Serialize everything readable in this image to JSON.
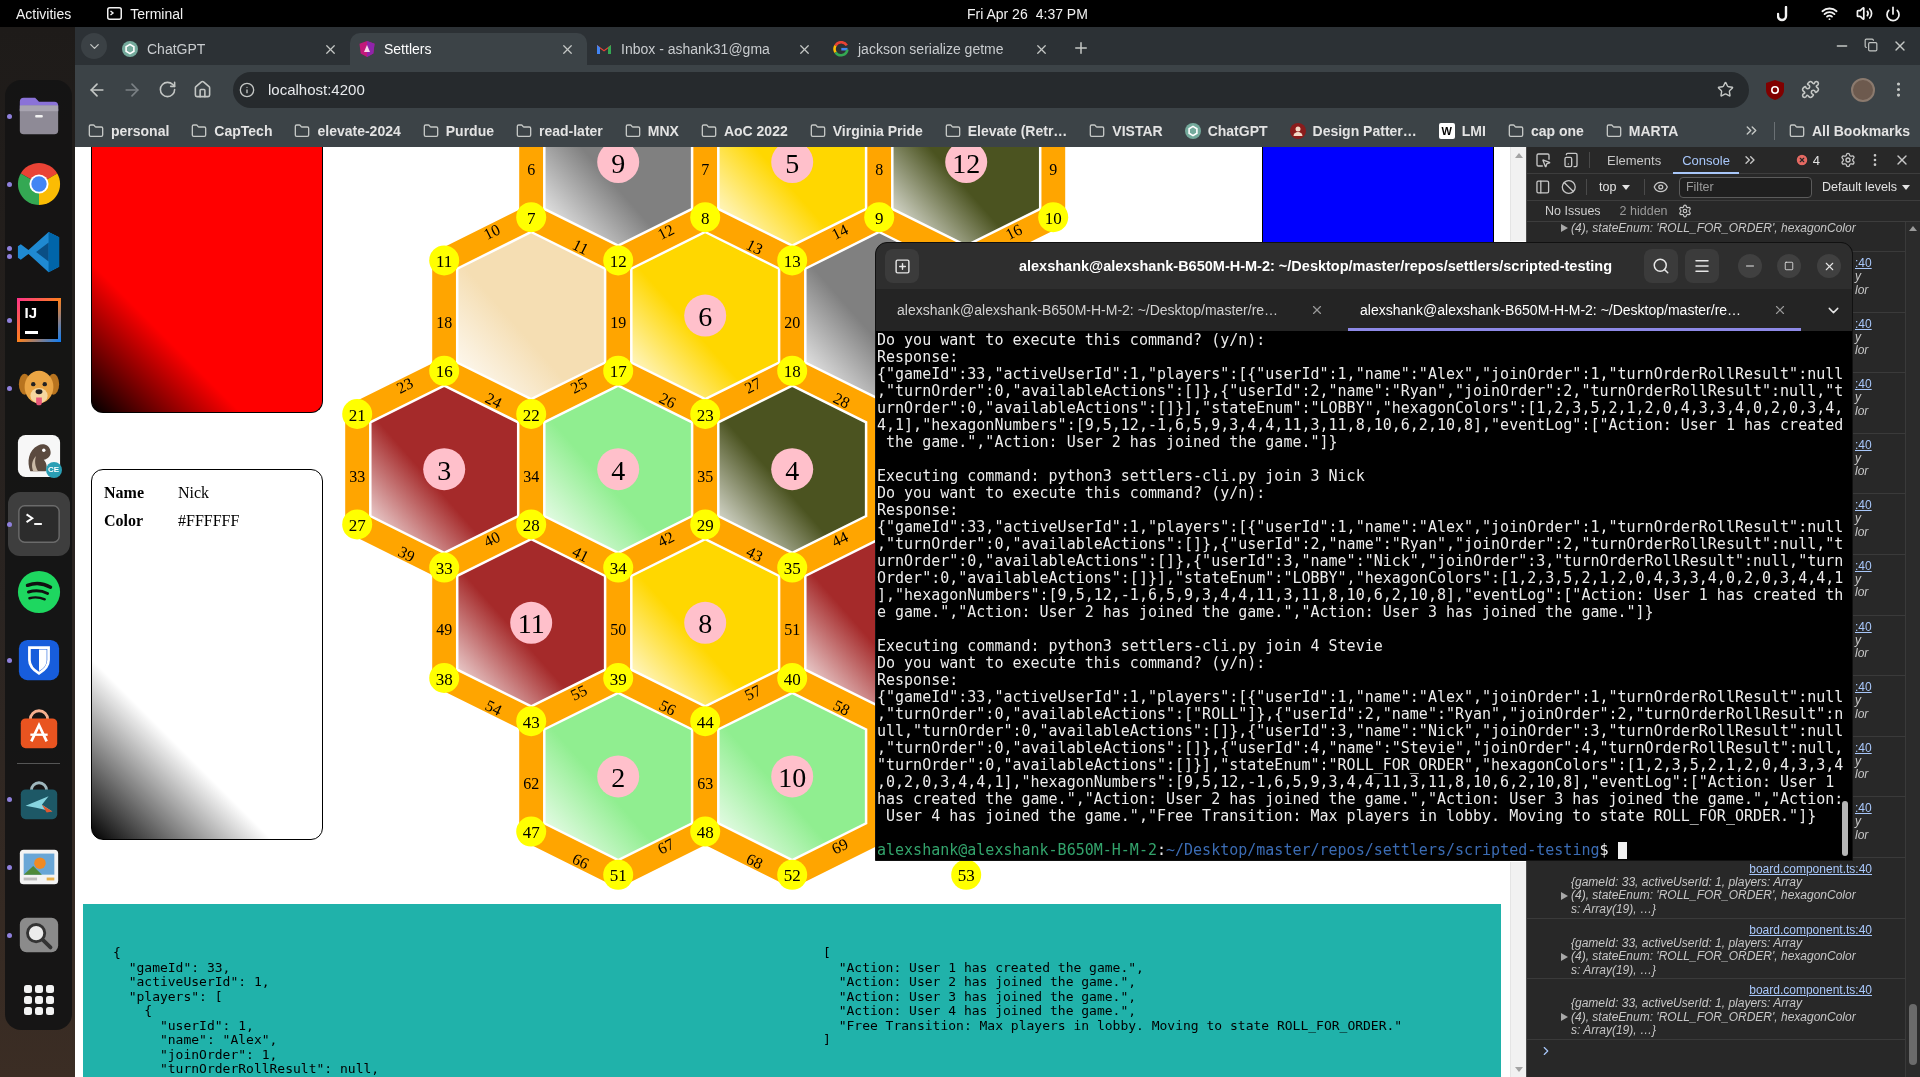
{
  "top_bar": {
    "activities": "Activities",
    "app_name": "Terminal",
    "date": "Fri Apr 26",
    "time": "4:37 PM"
  },
  "dock": {
    "apps": [
      {
        "kind": "files",
        "running": true,
        "multiple_windows": false,
        "selected": false
      },
      {
        "kind": "browser",
        "running": true,
        "multiple_windows": false,
        "selected": false
      },
      {
        "kind": "editor",
        "running": true,
        "multiple_windows": true,
        "selected": false
      },
      {
        "kind": "ide",
        "glyph": "IJ",
        "running": true,
        "multiple_windows": false,
        "selected": false
      },
      {
        "kind": "dog",
        "running": true,
        "multiple_windows": false,
        "selected": false
      },
      {
        "kind": "beaver",
        "glyph": "CE",
        "running": false,
        "multiple_windows": false,
        "selected": false
      },
      {
        "kind": "terminal",
        "running": true,
        "multiple_windows": false,
        "selected": true
      },
      {
        "kind": "music",
        "running": false,
        "multiple_windows": false,
        "selected": false
      },
      {
        "kind": "vault",
        "running": true,
        "multiple_windows": false,
        "selected": false
      },
      {
        "kind": "store",
        "running": false,
        "multiple_windows": false,
        "selected": false
      }
    ],
    "extra_apps": [
      {
        "kind": "bag",
        "running": true,
        "multiple_windows": false,
        "selected": false
      },
      {
        "kind": "photos",
        "running": true,
        "multiple_windows": false,
        "selected": false
      },
      {
        "kind": "search",
        "running": true,
        "multiple_windows": false,
        "selected": false
      }
    ]
  },
  "browser": {
    "tabs": [
      {
        "title": "ChatGPT",
        "kind": "knot",
        "selected": false
      },
      {
        "title": "Settlers",
        "kind": "shield",
        "selected": true
      },
      {
        "title": "Inbox - ashank31@gma",
        "kind": "mail",
        "selected": false
      },
      {
        "title": "jackson serialize getme",
        "kind": "ring",
        "selected": false
      }
    ],
    "url": "localhost:4200",
    "bookmarks": [
      {
        "title": "personal",
        "kind": "folder"
      },
      {
        "title": "CapTech",
        "kind": "folder"
      },
      {
        "title": "elevate-2024",
        "kind": "folder"
      },
      {
        "title": "Purdue",
        "kind": "folder"
      },
      {
        "title": "read-later",
        "kind": "folder"
      },
      {
        "title": "MNX",
        "kind": "folder"
      },
      {
        "title": "AoC 2022",
        "kind": "folder"
      },
      {
        "title": "Virginia Pride",
        "kind": "folder"
      },
      {
        "title": "Elevate (Retr…",
        "kind": "folder"
      },
      {
        "title": "VISTAR",
        "kind": "folder"
      },
      {
        "title": "ChatGPT",
        "kind": "knot"
      },
      {
        "title": "Design Patter…",
        "kind": "badge"
      },
      {
        "title": "LMI",
        "kind": "letter",
        "glyph": "W"
      },
      {
        "title": "cap one",
        "kind": "folder"
      },
      {
        "title": "MARTA",
        "kind": "folder"
      }
    ],
    "all_bookmarks": "All Bookmarks"
  },
  "page": {
    "left_cards": [
      {
        "color": "#ff0000"
      },
      {
        "color": "#ffffff",
        "fields": [
          {
            "label": "Name",
            "value": "Nick"
          },
          {
            "label": "Color",
            "value": "#FFFFFF"
          }
        ]
      }
    ],
    "right_cards": [
      {
        "color": "#0000ff"
      }
    ],
    "board": {
      "hex_rows": [
        [
          {
            "color": "#808080",
            "number": "9"
          },
          {
            "color": "#ffd700",
            "number": "5"
          },
          {
            "color": "#4b5320",
            "number": "12"
          }
        ],
        [
          {
            "color": "#f5deb3"
          },
          {
            "color": "#ffd700",
            "number": "6"
          },
          {
            "color": "#808080"
          }
        ],
        [
          {
            "color": "#a52a2a",
            "number": "3"
          },
          {
            "color": "#90ee90",
            "number": "4"
          },
          {
            "color": "#4b5320",
            "number": "4"
          }
        ],
        [
          {
            "color": "#a52a2a",
            "number": "11"
          },
          {
            "color": "#ffd700",
            "number": "8"
          },
          {
            "color": "#a52a2a"
          }
        ],
        [
          {
            "color": "#90ee90",
            "number": "2"
          },
          {
            "color": "#90ee90",
            "number": "10"
          }
        ]
      ],
      "vertex_rows": [
        [
          "7",
          "8",
          "9",
          "10"
        ],
        [
          "11",
          "12",
          "13"
        ],
        [
          "16",
          "17",
          "18"
        ],
        [
          "21",
          "22",
          "23"
        ],
        [
          "27",
          "28",
          "29"
        ],
        [
          "33",
          "34",
          "35"
        ],
        [
          "38",
          "39",
          "40"
        ],
        [
          "43",
          "44"
        ],
        [
          "47",
          "48"
        ],
        [
          "51",
          "52",
          "53"
        ]
      ],
      "edge_rows": [
        [
          "6",
          "7",
          "8",
          "9"
        ],
        [
          "10",
          "11",
          "12",
          "13",
          "14",
          null,
          "16"
        ],
        [
          "18",
          "19",
          "20"
        ],
        [
          "23",
          "24",
          "25",
          "26",
          "27",
          "28"
        ],
        [
          "33",
          "34",
          "35"
        ],
        [
          "39",
          "40",
          "41",
          "42",
          "43",
          "44"
        ],
        [
          "49",
          "50",
          "51"
        ],
        [
          "54",
          "55",
          "56",
          "57",
          "58"
        ],
        [
          "62",
          "63"
        ],
        [
          "66",
          "67",
          "68",
          "69"
        ]
      ]
    },
    "state_lines": [
      "{",
      "  \"gameId\": 33,",
      "  \"activeUserId\": 1,",
      "  \"players\": [",
      "    {",
      "      \"userId\": 1,",
      "      \"name\": \"Alex\",",
      "      \"joinOrder\": 1,",
      "      \"turnOrderRollResult\": null,"
    ],
    "event_lines": [
      "[",
      "  \"Action: User 1 has created the game.\",",
      "  \"Action: User 2 has joined the game.\",",
      "  \"Action: User 3 has joined the game.\",",
      "  \"Action: User 4 has joined the game.\",",
      "  \"Free Transition: Max players in lobby. Moving to state ROLL_FOR_ORDER.\"",
      "]"
    ]
  },
  "devtools": {
    "tabs": [
      {
        "label": "Elements",
        "selected": false
      },
      {
        "label": "Console",
        "selected": true
      }
    ],
    "error_count": "4",
    "context": "top",
    "filter_placeholder": "Filter",
    "levels": "Default levels",
    "issues": "No Issues",
    "hidden": "2 hidden",
    "messages": [
      {
        "kind": "tail",
        "lines": [
          "(4), stateEnum: 'ROLL_FOR_ORDER', hexagonColor"
        ]
      },
      {
        "kind": "partial",
        "fragments": [
          ":40",
          "y",
          "lor"
        ]
      },
      {
        "kind": "partial",
        "fragments": [
          ":40",
          "y",
          "lor"
        ]
      },
      {
        "kind": "partial",
        "fragments": [
          ":40",
          "y",
          "lor"
        ]
      },
      {
        "kind": "partial",
        "fragments": [
          ":40",
          "y",
          "lor"
        ]
      },
      {
        "kind": "partial",
        "fragments": [
          ":40",
          "y",
          "lor"
        ]
      },
      {
        "kind": "partial",
        "fragments": [
          ":40",
          "y",
          "lor"
        ]
      },
      {
        "kind": "partial",
        "fragments": [
          ":40",
          "y",
          "lor"
        ]
      },
      {
        "kind": "partial",
        "fragments": [
          ":40",
          "y",
          "lor"
        ]
      },
      {
        "kind": "partial",
        "fragments": [
          ":40",
          "y",
          "lor"
        ]
      },
      {
        "kind": "partial",
        "fragments": [
          ":40",
          "y",
          "lor"
        ]
      },
      {
        "kind": "full",
        "source": "board.component.ts:40",
        "lines": [
          "{gameId: 33, activeUserId: 1, players: Array",
          "(4), stateEnum: 'ROLL_FOR_ORDER', hexagonColor",
          "s: Array(19), …}"
        ]
      },
      {
        "kind": "full",
        "source": "board.component.ts:40",
        "lines": [
          "{gameId: 33, activeUserId: 1, players: Array",
          "(4), stateEnum: 'ROLL_FOR_ORDER', hexagonColor",
          "s: Array(19), …}"
        ]
      },
      {
        "kind": "full",
        "source": "board.component.ts:40",
        "lines": [
          "{gameId: 33, activeUserId: 1, players: Array",
          "(4), stateEnum: 'ROLL_FOR_ORDER', hexagonColor",
          "s: Array(19), …}"
        ]
      }
    ]
  },
  "terminal": {
    "title": "alexshank@alexshank-B650M-H-M-2: ~/Desktop/master/repos/settlers/scripted-testing",
    "tabs": [
      {
        "title": "alexshank@alexshank-B650M-H-M-2: ~/Desktop/master/re…",
        "selected": false
      },
      {
        "title": "alexshank@alexshank-B650M-H-M-2: ~/Desktop/master/re…",
        "selected": true
      }
    ],
    "blocks": [
      {
        "lines": [
          "Do you want to execute this command? (y/n):",
          "Response:",
          "{\"gameId\":33,\"activeUserId\":1,\"players\":[{\"userId\":1,\"name\":\"Alex\",\"joinOrder\":1,\"turnOrderRollResult\":null",
          ",\"turnOrder\":0,\"availableActions\":[]},{\"userId\":2,\"name\":\"Ryan\",\"joinOrder\":2,\"turnOrderRollResult\":null,\"t",
          "urnOrder\":0,\"availableActions\":[]}],\"stateEnum\":\"LOBBY\",\"hexagonColors\":[1,2,3,5,2,1,2,0,4,3,3,4,0,2,0,3,4,",
          "4,1],\"hexagonNumbers\":[9,5,12,-1,6,5,9,3,4,4,11,3,11,8,10,6,2,10,8],\"eventLog\":[\"Action: User 1 has created",
          " the game.\",\"Action: User 2 has joined the game.\"]}"
        ]
      },
      {
        "lines": [
          "Executing command: python3 settlers-cli.py join 3 Nick",
          "Do you want to execute this command? (y/n):",
          "Response:",
          "{\"gameId\":33,\"activeUserId\":1,\"players\":[{\"userId\":1,\"name\":\"Alex\",\"joinOrder\":1,\"turnOrderRollResult\":null",
          ",\"turnOrder\":0,\"availableActions\":[]},{\"userId\":2,\"name\":\"Ryan\",\"joinOrder\":2,\"turnOrderRollResult\":null,\"t",
          "urnOrder\":0,\"availableActions\":[]},{\"userId\":3,\"name\":\"Nick\",\"joinOrder\":3,\"turnOrderRollResult\":null,\"turn",
          "Order\":0,\"availableActions\":[]}],\"stateEnum\":\"LOBBY\",\"hexagonColors\":[1,2,3,5,2,1,2,0,4,3,3,4,0,2,0,3,4,4,1",
          "],\"hexagonNumbers\":[9,5,12,-1,6,5,9,3,4,4,11,3,11,8,10,6,2,10,8],\"eventLog\":[\"Action: User 1 has created th",
          "e game.\",\"Action: User 2 has joined the game.\",\"Action: User 3 has joined the game.\"]}"
        ]
      },
      {
        "lines": [
          "Executing command: python3 settlers-cli.py join 4 Stevie",
          "Do you want to execute this command? (y/n):",
          "Response:",
          "{\"gameId\":33,\"activeUserId\":1,\"players\":[{\"userId\":1,\"name\":\"Alex\",\"joinOrder\":1,\"turnOrderRollResult\":null",
          ",\"turnOrder\":0,\"availableActions\":[\"ROLL\"]},{\"userId\":2,\"name\":\"Ryan\",\"joinOrder\":2,\"turnOrderRollResult\":n",
          "ull,\"turnOrder\":0,\"availableActions\":[]},{\"userId\":3,\"name\":\"Nick\",\"joinOrder\":3,\"turnOrderRollResult\":null",
          ",\"turnOrder\":0,\"availableActions\":[]},{\"userId\":4,\"name\":\"Stevie\",\"joinOrder\":4,\"turnOrderRollResult\":null,",
          "\"turnOrder\":0,\"availableActions\":[]}],\"stateEnum\":\"ROLL_FOR_ORDER\",\"hexagonColors\":[1,2,3,5,2,1,2,0,4,3,3,4",
          ",0,2,0,3,4,4,1],\"hexagonNumbers\":[9,5,12,-1,6,5,9,3,4,4,11,3,11,8,10,6,2,10,8],\"eventLog\":[\"Action: User 1",
          "has created the game.\",\"Action: User 2 has joined the game.\",\"Action: User 3 has joined the game.\",\"Action:",
          " User 4 has joined the game.\",\"Free Transition: Max players in lobby. Moving to state ROLL_FOR_ORDER.\"]}"
        ]
      }
    ],
    "prompt": {
      "user": "alexshank@alexshank-B650M-H-M-2",
      "separator": ":",
      "path": "~/Desktop/master/repos/settlers/scripted-testing",
      "symbol": "$"
    }
  }
}
